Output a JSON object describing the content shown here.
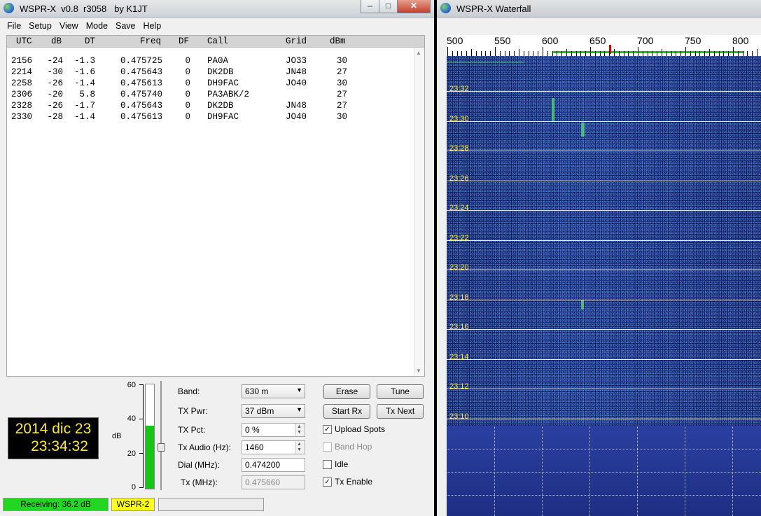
{
  "main_window": {
    "title": "WSPR-X  v0.8  r3058   by K1JT",
    "menu": [
      "File",
      "Setup",
      "View",
      "Mode",
      "Save",
      "Help"
    ],
    "columns": [
      "UTC",
      "dB",
      "DT",
      "Freq",
      "DF",
      "Call",
      "Grid",
      "dBm"
    ],
    "rows": [
      [
        "2156",
        "-24",
        "-1.3",
        "0.475725",
        "0",
        "PA0A",
        "JO33",
        "30"
      ],
      [
        "2214",
        "-30",
        "-1.6",
        "0.475643",
        "0",
        "DK2DB",
        "JN48",
        "27"
      ],
      [
        "2258",
        "-26",
        "-1.4",
        "0.475613",
        "0",
        "DH9FAC",
        "JO40",
        "30"
      ],
      [
        "2306",
        "-20",
        "5.8",
        "0.475740",
        "0",
        "PA3ABK/2",
        "",
        "27"
      ],
      [
        "2328",
        "-26",
        "-1.7",
        "0.475643",
        "0",
        "DK2DB",
        "JN48",
        "27"
      ],
      [
        "2330",
        "-28",
        "-1.4",
        "0.475613",
        "0",
        "DH9FAC",
        "JO40",
        "30"
      ]
    ],
    "clock": {
      "date": "2014 dic 23",
      "time": "23:34:32"
    },
    "meter": {
      "unit": "dB",
      "ticks": [
        "60",
        "40",
        "20",
        "0"
      ],
      "level_db": 36.2,
      "max_db": 60
    },
    "controls": {
      "band_label": "Band:",
      "band_value": "630 m",
      "txpwr_label": "TX Pwr:",
      "txpwr_value": "37 dBm",
      "txpct_label": "TX Pct:",
      "txpct_value": "0  %",
      "txaudio_label": "Tx Audio (Hz):",
      "txaudio_value": "1460",
      "dial_label": "Dial (MHz):",
      "dial_value": "0.474200",
      "tx_label": "Tx (MHz):",
      "tx_value": "0.475660"
    },
    "buttons": {
      "erase": "Erase",
      "tune": "Tune",
      "start_rx": "Start Rx",
      "tx_next": "Tx Next"
    },
    "checks": {
      "upload_spots": {
        "label": "Upload Spots",
        "checked": true
      },
      "band_hop": {
        "label": "Band Hop",
        "checked": false,
        "enabled": false
      },
      "idle": {
        "label": "Idle",
        "checked": false
      },
      "tx_enable": {
        "label": "Tx Enable",
        "checked": true
      }
    },
    "status": {
      "receiving": "Receiving:  36.2 dB",
      "mode": "WSPR-2",
      "receiving_color": "#22d622",
      "mode_color": "#ffff22"
    }
  },
  "waterfall_window": {
    "title": "WSPR-X Waterfall",
    "scale_labels": [
      "500",
      "550",
      "600",
      "650",
      "700",
      "750",
      "800"
    ],
    "time_labels": [
      "23:32",
      "23:30",
      "23:28",
      "23:26",
      "23:24",
      "23:22",
      "23:20",
      "23:18",
      "23:16",
      "23:14",
      "23:12",
      "23:10"
    ]
  }
}
